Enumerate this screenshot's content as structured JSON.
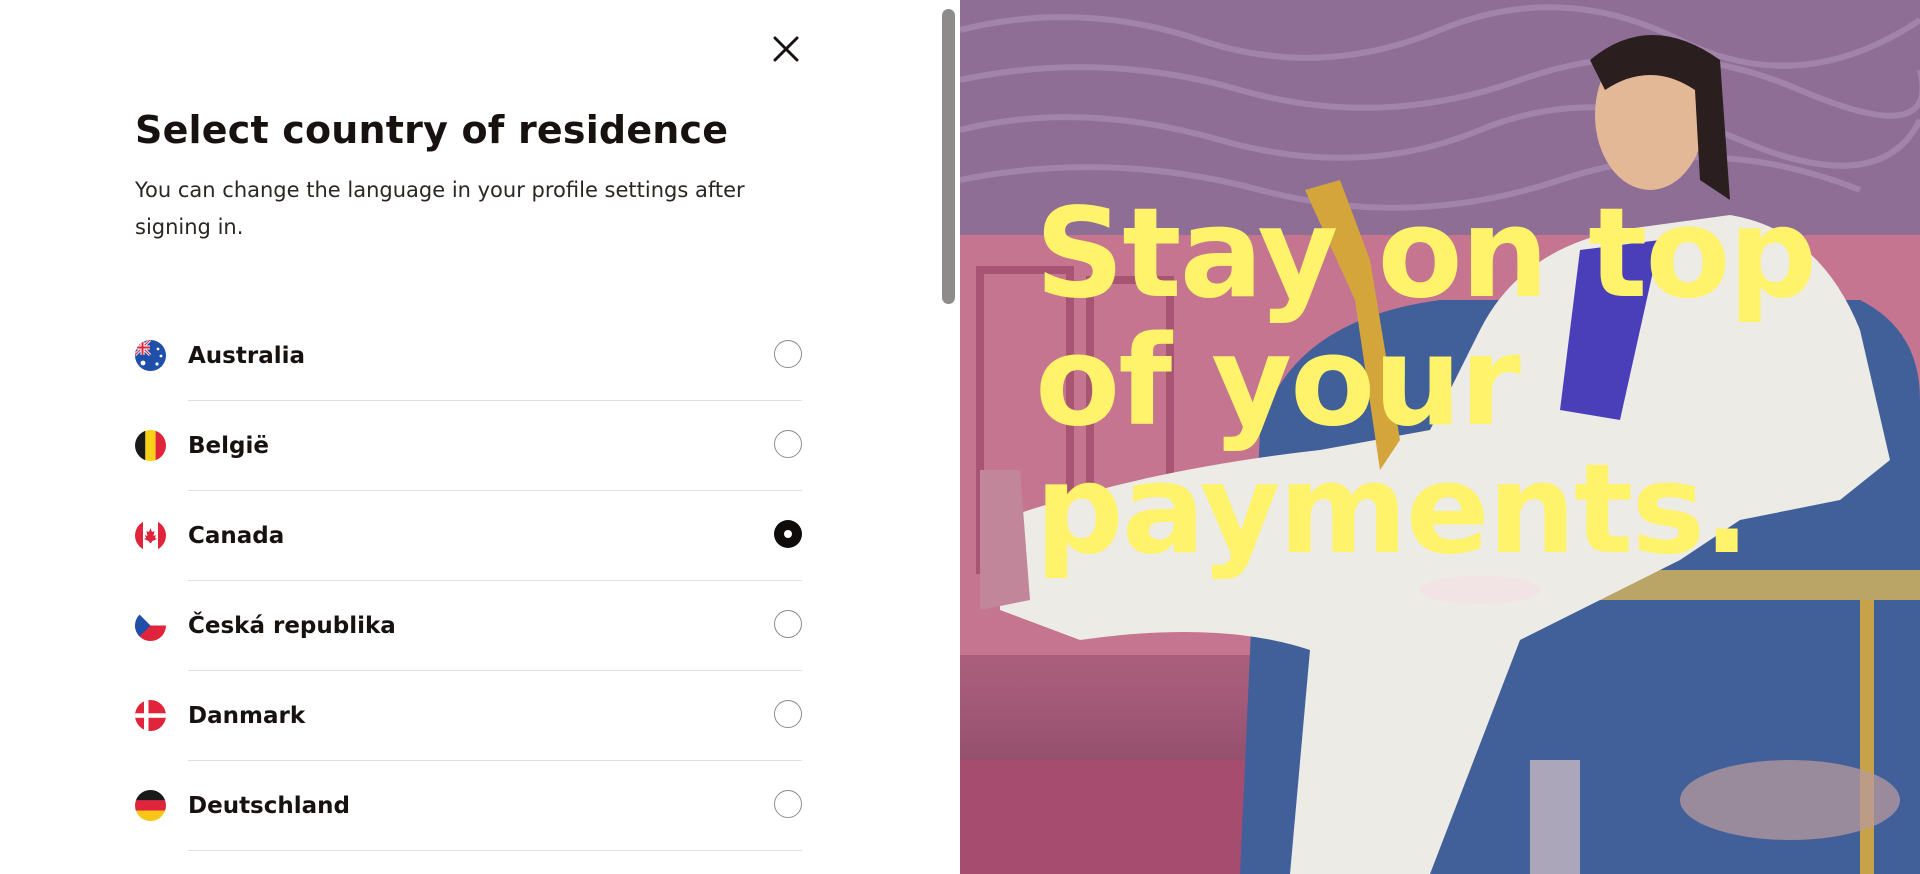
{
  "modal": {
    "title": "Select country of residence",
    "subtitle": "You can change the language in your profile settings after signing in.",
    "close_icon": "close-icon"
  },
  "countries": [
    {
      "name": "Australia",
      "flag": "australia-flag-icon",
      "selected": false
    },
    {
      "name": "België",
      "flag": "belgium-flag-icon",
      "selected": false
    },
    {
      "name": "Canada",
      "flag": "canada-flag-icon",
      "selected": true
    },
    {
      "name": "Česká republika",
      "flag": "czech-flag-icon",
      "selected": false
    },
    {
      "name": "Danmark",
      "flag": "denmark-flag-icon",
      "selected": false
    },
    {
      "name": "Deutschland",
      "flag": "germany-flag-icon",
      "selected": false
    }
  ],
  "hero": {
    "headline": "Stay on top of your payments.",
    "headline_color": "#fff36b"
  },
  "colors": {
    "text": "#17120f",
    "radio_selected": "#0f0c0a",
    "divider": "#e2e0de"
  }
}
